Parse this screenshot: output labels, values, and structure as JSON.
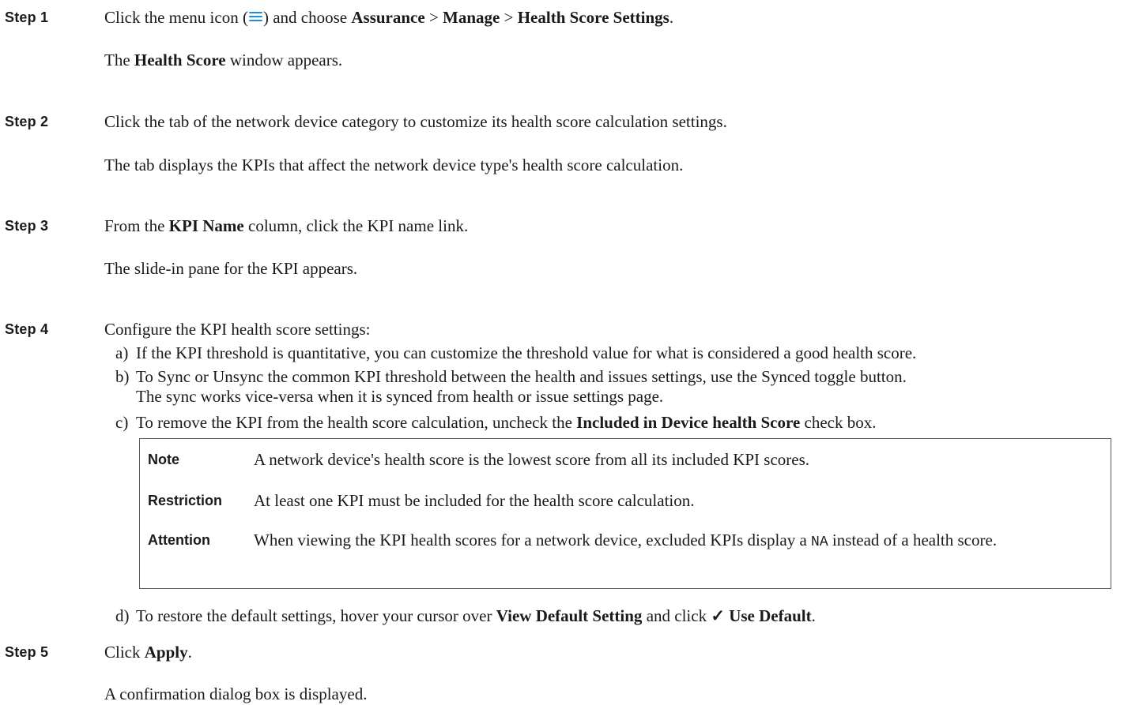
{
  "steps": [
    {
      "label": "Step 1",
      "instruction": {
        "pre": "Click the menu icon (",
        "post": ") and choose ",
        "assurance": "Assurance",
        "sep1": " > ",
        "manage": "Manage",
        "sep2": " > ",
        "health_settings": "Health Score Settings",
        "end": "."
      },
      "result": {
        "bold": "Health Score",
        "rest": " window appears.",
        "pre": "The "
      }
    },
    {
      "label": "Step 2",
      "instruction": "Click the tab of the network device category to customize its health score calculation settings.",
      "result": "The tab displays the KPIs that affect the network device type's health score calculation."
    },
    {
      "label": "Step 3",
      "instruction": {
        "pre": "From the ",
        "bold": "KPI Name",
        "post": " column, click the KPI name link."
      },
      "result": "The slide-in pane for the KPI appears."
    },
    {
      "label": "Step 4",
      "instruction": "Configure the KPI health score settings:",
      "substeps": {
        "a": {
          "letter": "a)",
          "text": "If the KPI threshold is quantitative, you can customize the threshold value for what is considered a good health score."
        },
        "b": {
          "letter": "b)",
          "line1": "To Sync or Unsync the common KPI threshold between the health and issues settings, use the Synced toggle button.",
          "line2": "The sync works vice-versa when it is synced from health or issue settings page."
        },
        "c": {
          "letter": "c)",
          "pre": "To remove the KPI from the health score calculation, uncheck the ",
          "bold": "Included in Device health Score",
          "post": " check box."
        },
        "d": {
          "letter": "d)",
          "pre": "To restore the default settings, hover your cursor over ",
          "bold1": "View Default Setting",
          "mid": " and click ",
          "check": "✓",
          "bold2": " Use Default",
          "post": "."
        }
      },
      "notes": {
        "note": {
          "label": "Note",
          "text": "A network device's health score is the lowest score from all its included KPI scores."
        },
        "restriction": {
          "label": "Restriction",
          "text": "At least one KPI must be included for the health score calculation."
        },
        "attention": {
          "label": "Attention",
          "pre": "When viewing the KPI health scores for a network device, excluded KPIs display a ",
          "code": "NA",
          "post": " instead of a health score."
        }
      }
    },
    {
      "label": "Step 5",
      "instruction": {
        "pre": "Click ",
        "bold": "Apply",
        "post": "."
      },
      "result": "A confirmation dialog box is displayed."
    }
  ],
  "icons": {
    "menu": "menu-icon",
    "menu_color": "#1e8fd6"
  }
}
